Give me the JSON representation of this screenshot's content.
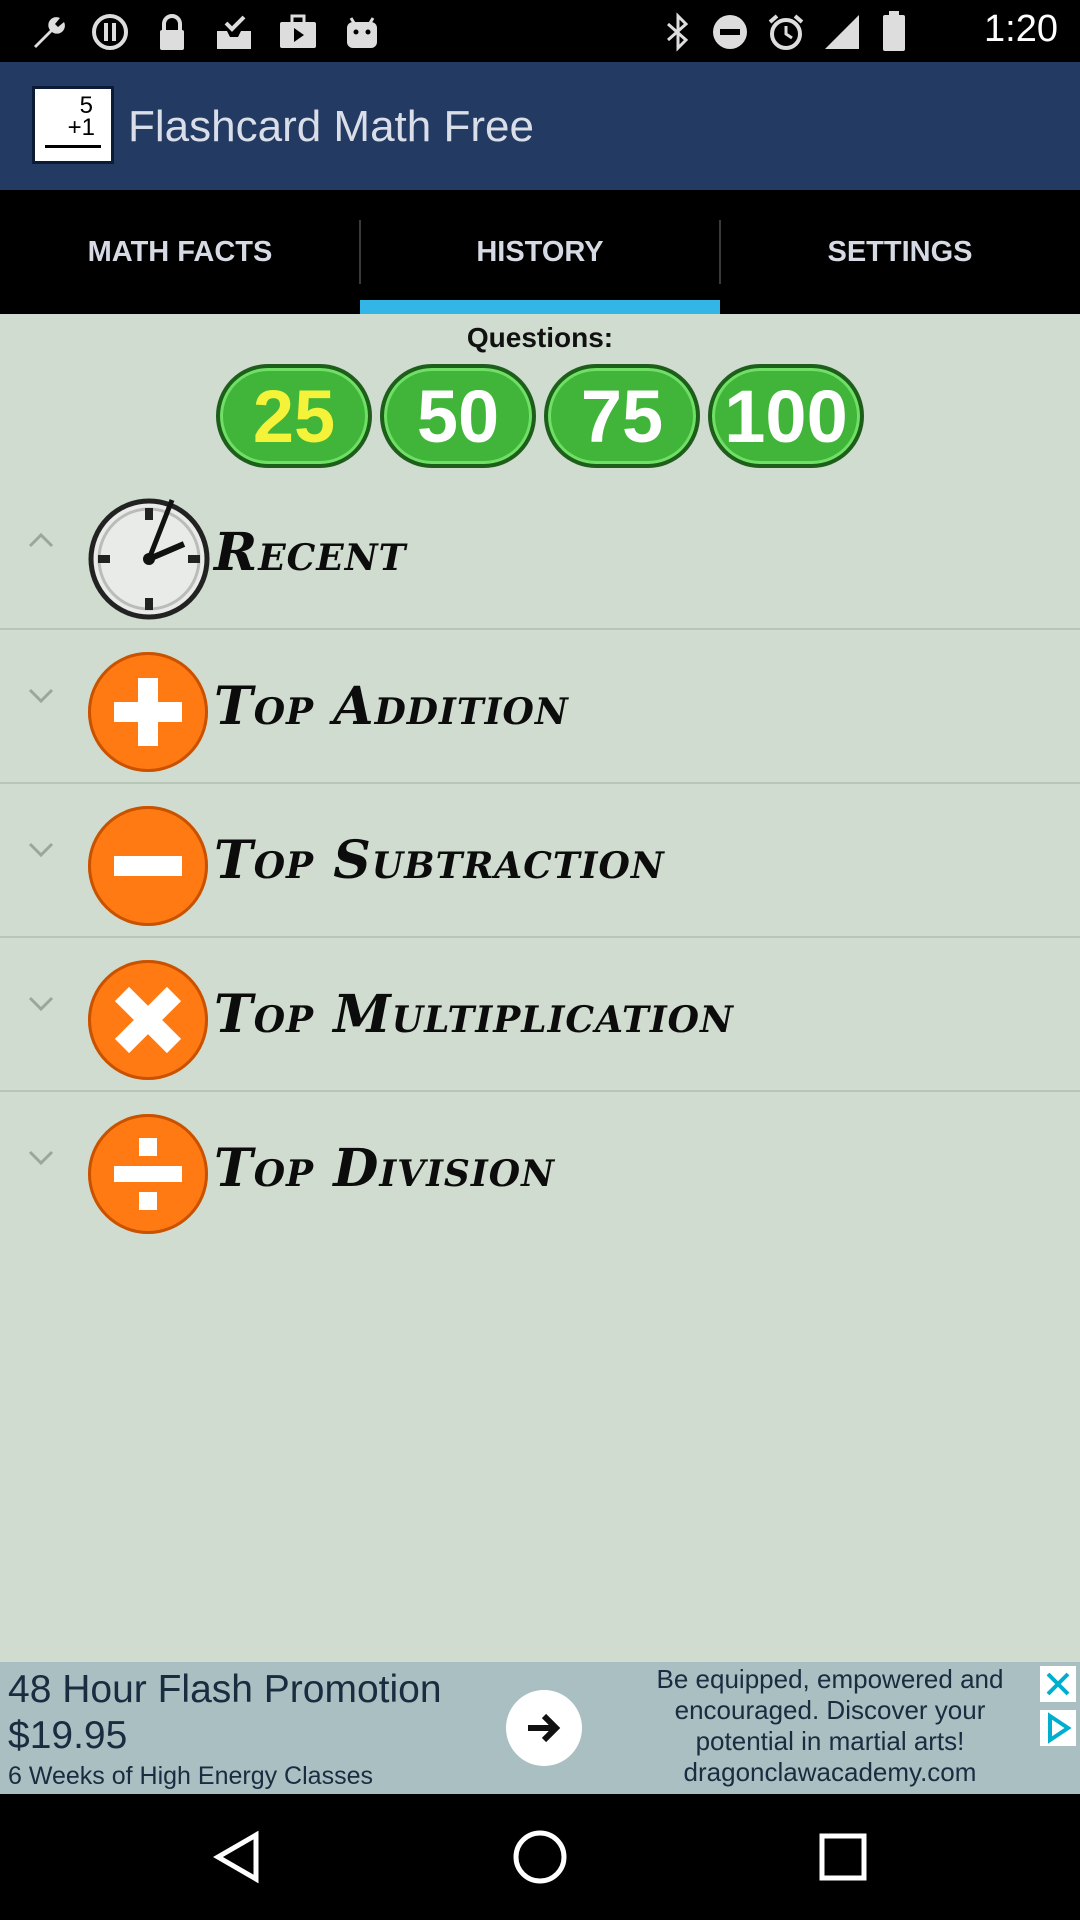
{
  "status_bar": {
    "time": "1:20",
    "icons": [
      "wrench-icon",
      "circle-info-icon",
      "lock-icon",
      "inbox-check-icon",
      "briefcase-play-icon",
      "android-icon",
      "bluetooth-icon",
      "do-not-disturb-icon",
      "alarm-icon",
      "signal-icon",
      "battery-icon"
    ]
  },
  "app": {
    "logo_line1": "5",
    "logo_line2": "+1",
    "title": "Flashcard Math Free"
  },
  "tabs": [
    {
      "label": "MATH FACTS",
      "selected": false
    },
    {
      "label": "HISTORY",
      "selected": true
    },
    {
      "label": "SETTINGS",
      "selected": false
    }
  ],
  "questions": {
    "label": "Questions:",
    "options": [
      {
        "label": "25",
        "selected": true
      },
      {
        "label": "50",
        "selected": false
      },
      {
        "label": "75",
        "selected": false
      },
      {
        "label": "100",
        "selected": false
      }
    ]
  },
  "history_groups": [
    {
      "label": "Recent",
      "icon": "clock-icon",
      "expanded": true
    },
    {
      "label": "Top Addition",
      "icon": "plus-icon",
      "expanded": false
    },
    {
      "label": "Top Subtraction",
      "icon": "minus-icon",
      "expanded": false
    },
    {
      "label": "Top Multiplication",
      "icon": "multiply-icon",
      "expanded": false
    },
    {
      "label": "Top Division",
      "icon": "divide-icon",
      "expanded": false
    }
  ],
  "ad": {
    "headline": "48 Hour Flash Promotion",
    "price": "$19.95",
    "subline": "6 Weeks of High Energy Classes",
    "body": "Be equipped, empowered and encouraged. Discover your potential in martial arts!",
    "domain": "dragonclawacademy.com"
  },
  "colors": {
    "action_bar": "#233a63",
    "tab_indicator": "#33b5e5",
    "background": "#cfdccf",
    "question_button": "#41b53a",
    "selected_question_text": "#f5f23a",
    "category_icon": "#ff7a12"
  }
}
